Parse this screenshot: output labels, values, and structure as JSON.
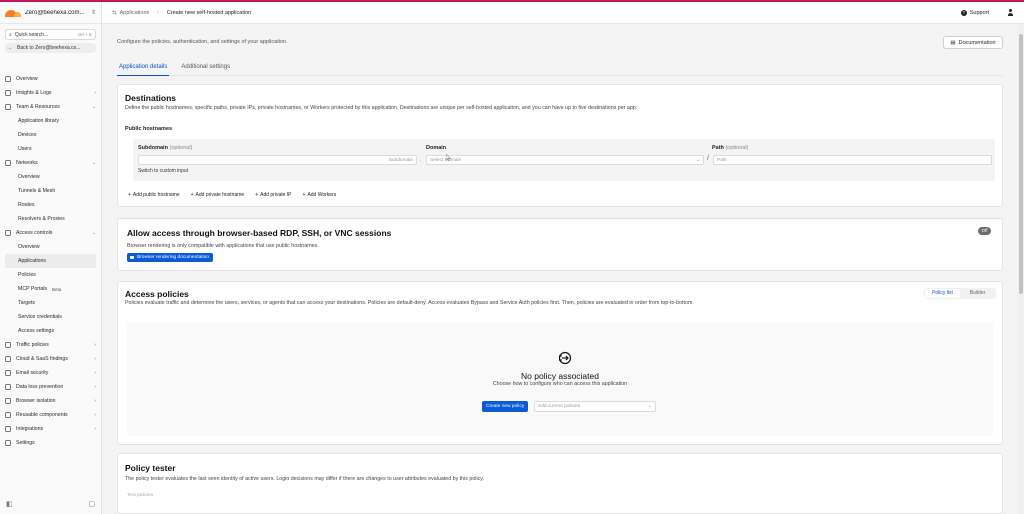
{
  "account": {
    "name": "Zero@beehexa.com..."
  },
  "sidebar": {
    "search_placeholder": "Quick search...",
    "search_shortcut": "ctrl + K",
    "back_label": "Back to Zero@beehexa.co...",
    "items": [
      {
        "label": "Overview",
        "arrow": ""
      },
      {
        "label": "Insights & Logs",
        "arrow": "›"
      },
      {
        "label": "Team & Resources",
        "arrow": "⌄"
      },
      {
        "label": "Application library",
        "arrow": ""
      },
      {
        "label": "Devices",
        "arrow": ""
      },
      {
        "label": "Users",
        "arrow": ""
      },
      {
        "label": "Networks",
        "arrow": "⌄"
      },
      {
        "label": "Overview",
        "arrow": ""
      },
      {
        "label": "Tunnels & Mesh",
        "arrow": ""
      },
      {
        "label": "Routes",
        "arrow": ""
      },
      {
        "label": "Resolvers & Proxies",
        "arrow": ""
      },
      {
        "label": "Access controls",
        "arrow": "⌄"
      },
      {
        "label": "Overview",
        "arrow": ""
      },
      {
        "label": "Applications",
        "arrow": ""
      },
      {
        "label": "Policies",
        "arrow": ""
      },
      {
        "label": "MCP Portals",
        "arrow": "",
        "badge": "Beta"
      },
      {
        "label": "Targets",
        "arrow": ""
      },
      {
        "label": "Service credentials",
        "arrow": ""
      },
      {
        "label": "Access settings",
        "arrow": ""
      },
      {
        "label": "Traffic policies",
        "arrow": "›"
      },
      {
        "label": "Cloud & SaaS findings",
        "arrow": "›"
      },
      {
        "label": "Email security",
        "arrow": "›"
      },
      {
        "label": "Data loss prevention",
        "arrow": "›"
      },
      {
        "label": "Browser isolation",
        "arrow": "›"
      },
      {
        "label": "Reusable components",
        "arrow": "›"
      },
      {
        "label": "Integrations",
        "arrow": "›"
      },
      {
        "label": "Settings",
        "arrow": ""
      }
    ]
  },
  "header": {
    "breadcrumb_parent": "Applications",
    "breadcrumb_current": "Create new self-hosted application",
    "support_label": "Support"
  },
  "main": {
    "intro": "Configure the policies, authentication, and settings of your application.",
    "documentation_label": "Documentation",
    "tabs": [
      {
        "label": "Application details"
      },
      {
        "label": "Additional settings"
      }
    ]
  },
  "destinations": {
    "title": "Destinations",
    "description": "Define the public hostnames, specific paths, private IPs, private hostnames, or Workers protected by this application. Destinations are unique per self-hosted application, and you can have up to five destinations per app.",
    "public_hostnames_label": "Public hostnames",
    "subdomain_label": "Subdomain",
    "optional": "(optional)",
    "domain_label": "Domain",
    "path_label": "Path",
    "subdomain_placeholder": "Subdomain",
    "domain_placeholder": "Select Domain",
    "path_placeholder": "Path",
    "switch_label": "Switch to custom input",
    "add_buttons": [
      "Add public hostname",
      "Add private hostname",
      "Add private IP",
      "Add Workers"
    ]
  },
  "rdp": {
    "title": "Allow access through browser-based RDP, SSH, or VNC sessions",
    "description": "Browser rendering is only compatible with applications that use public hostnames.",
    "toggle_label": "Off",
    "doc_label": "Browser rendering documentation"
  },
  "policies": {
    "title": "Access policies",
    "description": "Policies evaluate traffic and determine the users, services, or agents that can access your destinations. Policies are default-deny. Access evaluates Bypass and Service Auth policies first. Then, policies are evaluated in order from top-to-bottom.",
    "view_options": [
      "Policy list",
      "Builder"
    ],
    "empty_title": "No policy associated",
    "empty_sub": "Choose how to configure who can access this application",
    "create_label": "Create new policy",
    "add_current_placeholder": "Add current policies"
  },
  "tester": {
    "title": "Policy tester",
    "description": "The policy tester evaluates the last seen identity of active users. Login decisions may differ if there are changes to user attributes evaluated by this policy.",
    "test_label": "Test policies"
  },
  "colors": {
    "accent": "#0b5ad7",
    "brand": "#f38020",
    "topline": "#c2185b"
  }
}
